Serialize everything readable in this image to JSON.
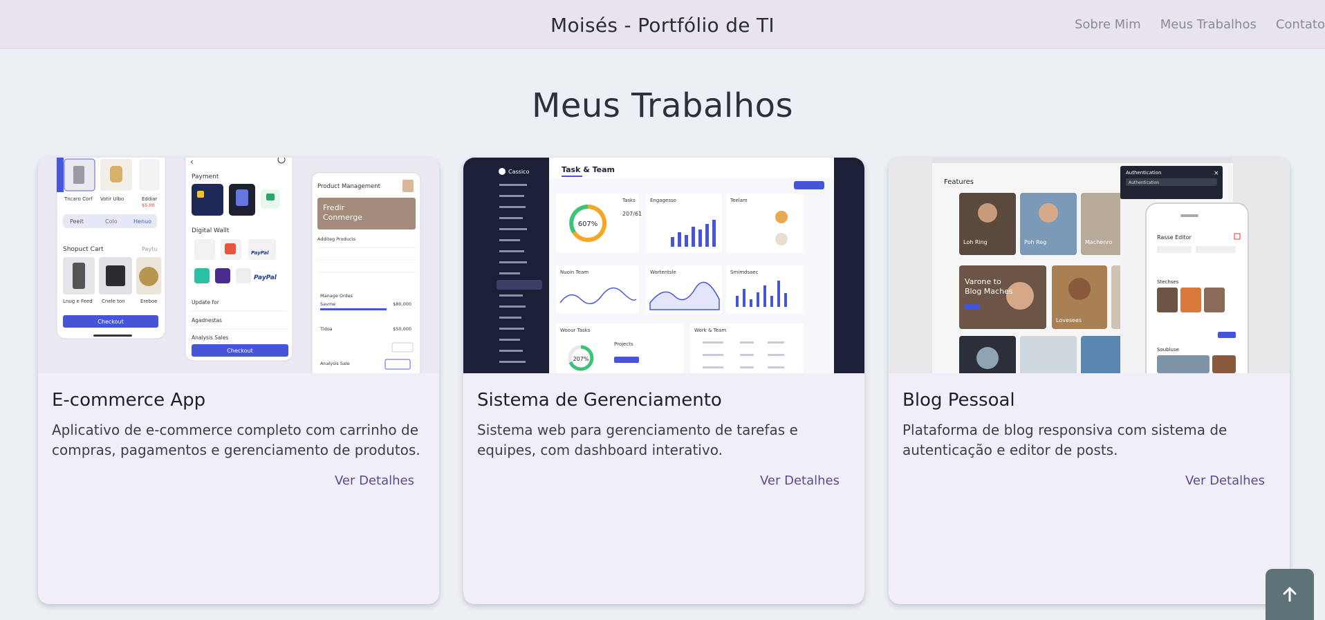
{
  "nav": {
    "brand": "Moisés - Portfólio de TI",
    "links": [
      {
        "label": "Sobre Mim"
      },
      {
        "label": "Meus Trabalhos"
      },
      {
        "label": "Contato"
      }
    ]
  },
  "section": {
    "title": "Meus Trabalhos"
  },
  "projects": [
    {
      "title": "E-commerce App",
      "description": "Aplicativo de e-commerce completo com carrinho de compras, pagamentos e gerenciamento de produtos.",
      "link": "Ver Detalhes",
      "image_text": {
        "cart1": "Tncaro Corf",
        "cart2": "Votir Ulbo",
        "cart3": "Eddiar",
        "price3": "$5.00",
        "tab1": "Peeit",
        "tab2": "Colo",
        "tab3": "Henuo",
        "shop_title": "Shopuct Cart",
        "shop_side": "Paytu",
        "item1": "Lnug e Feed",
        "item2": "Cnele ton",
        "item3": "Ereboe",
        "checkout": "Checkout",
        "payment": "Payment",
        "wallet": "Digital Wallt",
        "paypal": "PayPal",
        "update": "Update for",
        "agenda": "Agadnestas",
        "analysis": "Analysis Sales",
        "pm_title": "Product Management",
        "pm_banner1": "Fredir",
        "pm_banner2": "Conmerge",
        "pm_add": "Additeg Products",
        "pm_manage": "Manage Ordes",
        "pm_save": "Savme",
        "pm_price1": "$80,000",
        "pm_total": "Tidoa",
        "pm_price2": "$50,000",
        "pm_analysis": "Analysis Sale"
      }
    },
    {
      "title": "Sistema de Gerenciamento",
      "description": "Sistema web para gerenciamento de tarefas e equipes, com dashboard interativo.",
      "link": "Ver Detalhes",
      "image_text": {
        "app_name": "Cassico",
        "header": "Task & Team",
        "gauge1": "607%",
        "tasks": "Tasks",
        "tasks_val": "207/61",
        "engagement": "Engagesso",
        "team": "Teelam",
        "chart1": "Nuoin Team",
        "chart2": "Wortentsle",
        "chart3": "Smimdsaec",
        "tasks2": "Woour Tasks",
        "gauge2": "207%",
        "projects": "Projects",
        "work_team": "Work & Team"
      }
    },
    {
      "title": "Blog Pessoal",
      "description": "Plataforma de blog responsiva com sistema de autenticação e editor de posts.",
      "link": "Ver Detalhes",
      "image_text": {
        "features": "Features",
        "tile1": "Loh Ring",
        "tile2": "Poh Reg",
        "tile3": "Machenro",
        "hero1": "Varone to",
        "hero2": "Blog Maches",
        "tile4": "Lovesees",
        "auth": "Authentication",
        "auth_field": "Authentication",
        "editor": "Rasse Editor",
        "recent": "Stechses",
        "recent2": "Soubluse"
      }
    }
  ],
  "colors": {
    "navbar": "#e8e3ef",
    "background": "#eceff3",
    "card": "#f2eef7",
    "link": "#5a4a8f",
    "back_to_top": "#5d7377"
  },
  "icons": {
    "back_to_top": "arrow-up-icon"
  }
}
